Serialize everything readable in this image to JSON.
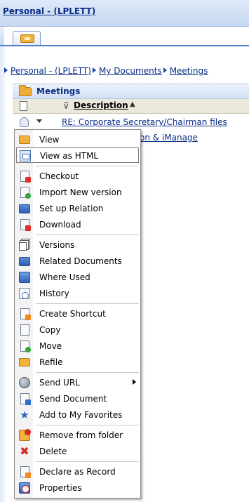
{
  "header": {
    "title": "Personal - (LPLETT)"
  },
  "breadcrumb": {
    "items": [
      "Personal - (LPLETT)",
      "My Documents",
      "Meetings"
    ]
  },
  "folder": {
    "name": "Meetings"
  },
  "columns": {
    "description": "Description",
    "sort_indicator": "▲"
  },
  "rows": [
    {
      "text": "RE: Corporate Secretary/Chairman files"
    },
    {
      "text": "on & iManage"
    }
  ],
  "context_menu": {
    "items": [
      {
        "label": "View",
        "icon": "folder-open-icon"
      },
      {
        "label": "View as HTML",
        "icon": "html-view-icon"
      },
      {
        "label": "Checkout",
        "icon": "checkout-icon"
      },
      {
        "label": "Import New version",
        "icon": "import-version-icon"
      },
      {
        "label": "Set up Relation",
        "icon": "relation-icon"
      },
      {
        "label": "Download",
        "icon": "download-icon"
      },
      {
        "label": "Versions",
        "icon": "versions-icon"
      },
      {
        "label": "Related Documents",
        "icon": "related-documents-icon"
      },
      {
        "label": "Where Used",
        "icon": "where-used-icon"
      },
      {
        "label": "History",
        "icon": "history-icon"
      },
      {
        "label": "Create Shortcut",
        "icon": "shortcut-icon"
      },
      {
        "label": "Copy",
        "icon": "copy-icon"
      },
      {
        "label": "Move",
        "icon": "move-icon"
      },
      {
        "label": "Refile",
        "icon": "refile-icon"
      },
      {
        "label": "Send URL",
        "icon": "send-url-icon"
      },
      {
        "label": "Send Document",
        "icon": "send-document-icon"
      },
      {
        "label": "Add to My Favorites",
        "icon": "favorites-icon"
      },
      {
        "label": "Remove from folder",
        "icon": "remove-folder-icon"
      },
      {
        "label": "Delete",
        "icon": "delete-icon"
      },
      {
        "label": "Declare as Record",
        "icon": "declare-record-icon"
      },
      {
        "label": "Properties",
        "icon": "properties-icon"
      }
    ],
    "hovered": "View as HTML"
  },
  "colors": {
    "link": "#0a2d86",
    "header_bg": "#c6d8f2",
    "menu_border": "#8d8d8d"
  }
}
